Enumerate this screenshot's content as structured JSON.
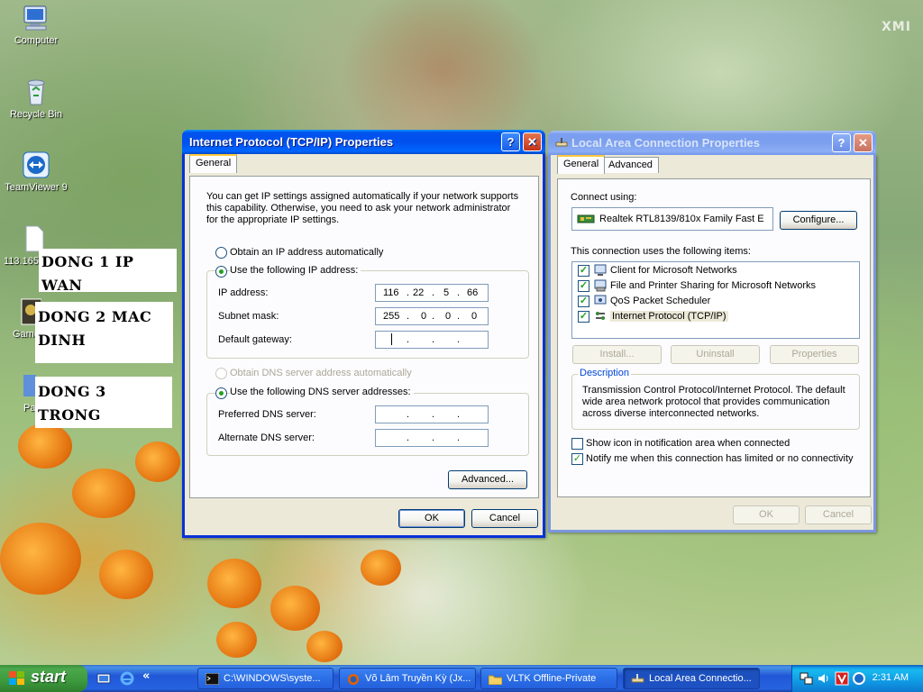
{
  "desktop": {
    "watermark": "XMI",
    "icons": [
      {
        "label": "Computer"
      },
      {
        "label": "Recycle Bin"
      },
      {
        "label": "TeamViewer 9"
      },
      {
        "label": "113.165"
      },
      {
        "label": "Game"
      },
      {
        "label": "Pa"
      }
    ],
    "notes": [
      "DONG 1 IP WAN",
      "DONG 2 MAC DINH",
      "DONG 3 TRONG"
    ]
  },
  "tcpip_dialog": {
    "title": "Internet Protocol (TCP/IP) Properties",
    "tab_general": "General",
    "description": "You can get IP settings assigned automatically if your network supports this capability. Otherwise, you need to ask your network administrator for the appropriate IP settings.",
    "radio_auto_ip": "Obtain an IP address automatically",
    "radio_static_ip": "Use the following IP address:",
    "ip_label": "IP address:",
    "ip_value": [
      "116",
      "22",
      "5",
      "66"
    ],
    "subnet_label": "Subnet mask:",
    "subnet_value": [
      "255",
      "0",
      "0",
      "0"
    ],
    "gateway_label": "Default gateway:",
    "radio_auto_dns": "Obtain DNS server address automatically",
    "radio_static_dns": "Use the following DNS server addresses:",
    "preferred_dns_label": "Preferred DNS server:",
    "alternate_dns_label": "Alternate DNS server:",
    "advanced_button": "Advanced...",
    "ok_button": "OK",
    "cancel_button": "Cancel"
  },
  "lan_dialog": {
    "title": "Local Area Connection Properties",
    "tab_general": "General",
    "tab_advanced": "Advanced",
    "connect_using_label": "Connect using:",
    "adapter": "Realtek RTL8139/810x Family Fast E",
    "configure_button": "Configure...",
    "items_label": "This connection uses the following items:",
    "items": [
      {
        "label": "Client for Microsoft Networks",
        "checked": true
      },
      {
        "label": "File and Printer Sharing for Microsoft Networks",
        "checked": true
      },
      {
        "label": "QoS Packet Scheduler",
        "checked": true
      },
      {
        "label": "Internet Protocol (TCP/IP)",
        "checked": true
      }
    ],
    "install_button": "Install...",
    "uninstall_button": "Uninstall",
    "properties_button": "Properties",
    "description_legend": "Description",
    "description_text": "Transmission Control Protocol/Internet Protocol. The default wide area network protocol that provides communication across diverse interconnected networks.",
    "show_icon_label": "Show icon in notification area when connected",
    "notify_label": "Notify me when this connection has limited or no connectivity",
    "ok_button": "OK",
    "cancel_button": "Cancel"
  },
  "taskbar": {
    "start_label": "start",
    "quicklaunch_more": "«",
    "tasks": [
      {
        "label": "C:\\WINDOWS\\syste..."
      },
      {
        "label": "Võ Lâm Truyền Kỳ (Jx..."
      },
      {
        "label": "VLTK Offline-Private"
      },
      {
        "label": "Local Area Connectio..."
      }
    ],
    "clock": "2:31 AM",
    "accent": "#2157d7"
  }
}
